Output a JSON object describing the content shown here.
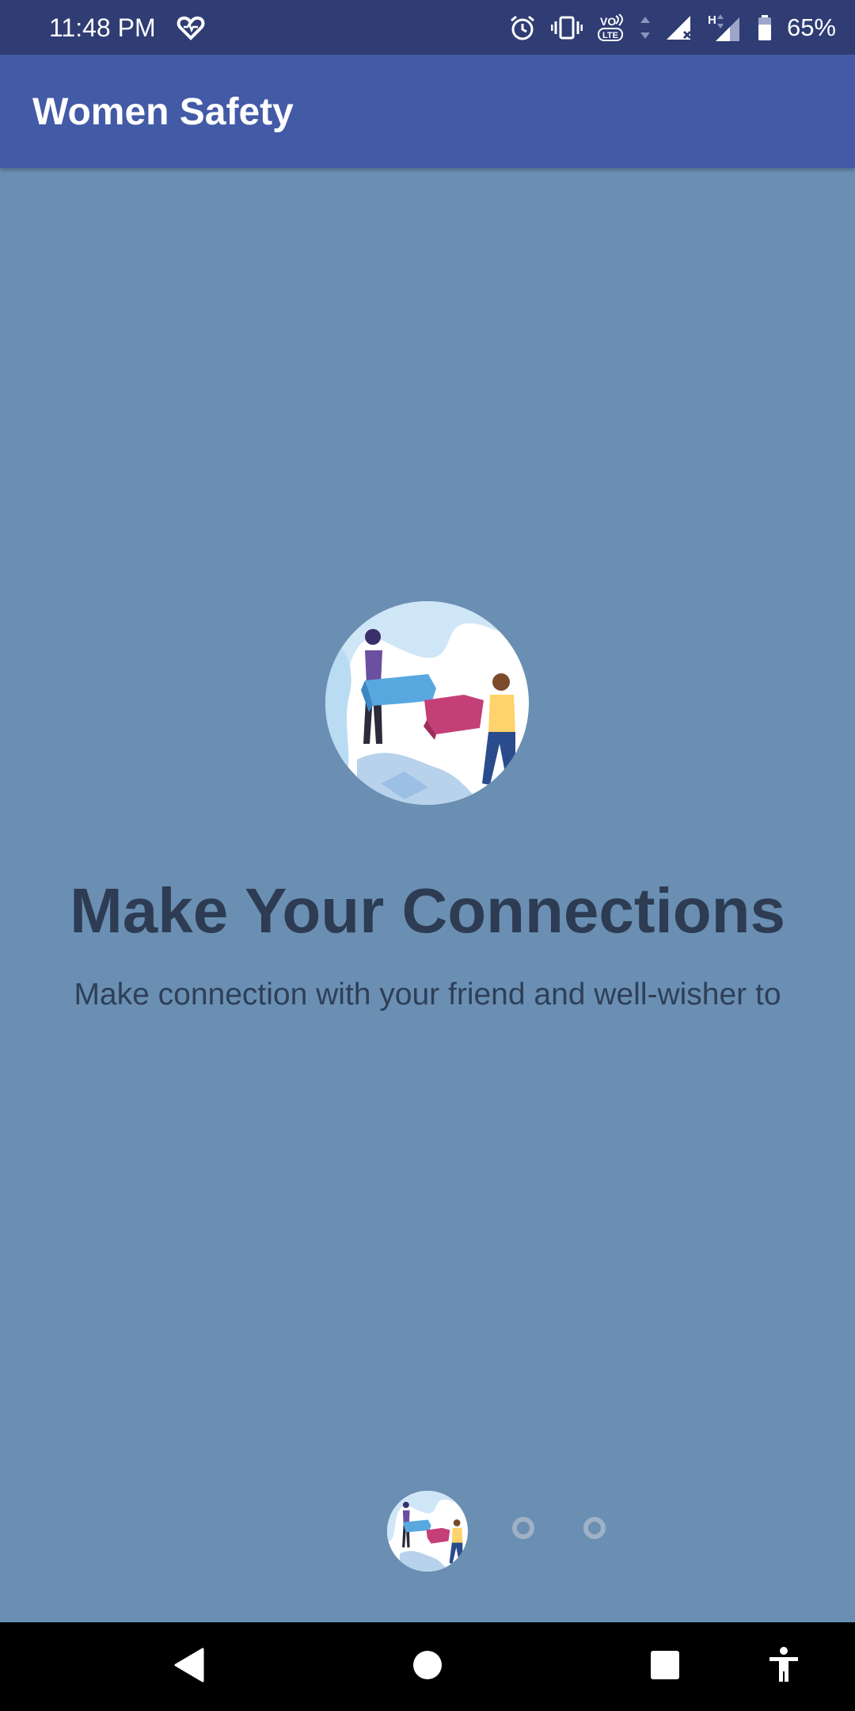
{
  "status_bar": {
    "time": "11:48 PM",
    "battery": "65%",
    "icons": [
      "heart-icon",
      "alarm-icon",
      "vibrate-icon",
      "volte-icon",
      "signal-icon",
      "signal-h-icon",
      "battery-icon"
    ],
    "network_label": "H"
  },
  "app_bar": {
    "title": "Women Safety"
  },
  "slide": {
    "title": "Make Your Connections",
    "description": "Make connection with your friend and well-wisher to",
    "illustration": "puzzle-connection-illustration"
  },
  "indicator": {
    "current_page": 1,
    "total_pages": 3
  },
  "nav_bar": {
    "icons": [
      "back-icon",
      "home-icon",
      "recents-icon",
      "accessibility-icon"
    ]
  },
  "colors": {
    "status_bar": "#2f3d74",
    "app_bar": "#435aa6",
    "background": "#6a8fb3",
    "title_text": "#2d3c52"
  }
}
